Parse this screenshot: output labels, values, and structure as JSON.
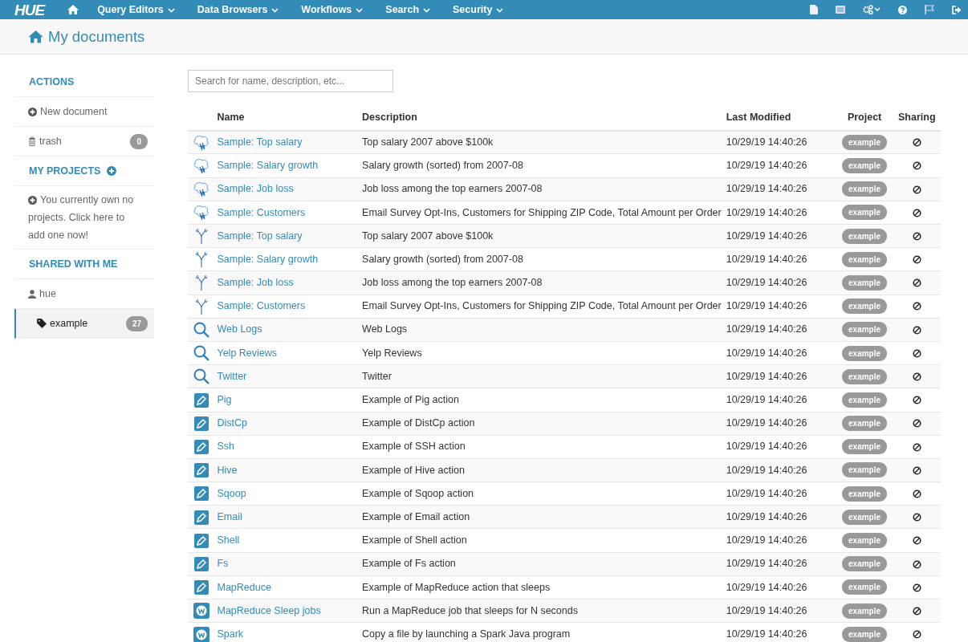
{
  "navbar": {
    "brand": "HUE",
    "menus": [
      {
        "label": "Query Editors"
      },
      {
        "label": "Data Browsers"
      },
      {
        "label": "Workflows"
      },
      {
        "label": "Search"
      },
      {
        "label": "Security"
      }
    ]
  },
  "page_title": "My documents",
  "sidebar": {
    "sections": [
      {
        "heading": "ACTIONS",
        "add": false,
        "items": [
          {
            "kind": "new",
            "label": "New document",
            "selected": false
          },
          {
            "kind": "trash",
            "label": "trash",
            "count": "0",
            "selected": false
          }
        ]
      },
      {
        "heading": "MY PROJECTS",
        "add": true,
        "items": [
          {
            "kind": "note",
            "label": "You currently own no projects. Click here to add one now!",
            "selected": false
          }
        ]
      },
      {
        "heading": "SHARED WITH ME",
        "add": false,
        "items": [
          {
            "kind": "user",
            "label": "hue",
            "selected": false
          },
          {
            "kind": "tag",
            "label": "example",
            "count": "27",
            "selected": true
          }
        ]
      }
    ]
  },
  "search": {
    "placeholder": "Search for name, description, etc..."
  },
  "table": {
    "columns": [
      "Name",
      "Description",
      "Last Modified",
      "Project",
      "Sharing"
    ],
    "rows": [
      {
        "kind": "hive",
        "name": "Sample: Top salary",
        "description": "Top salary 2007 above $100k",
        "modified": "10/29/19 14:40:26",
        "project": "example"
      },
      {
        "kind": "hive",
        "name": "Sample: Salary growth",
        "description": "Salary growth (sorted) from 2007-08",
        "modified": "10/29/19 14:40:26",
        "project": "example"
      },
      {
        "kind": "hive",
        "name": "Sample: Job loss",
        "description": "Job loss among the top earners 2007-08",
        "modified": "10/29/19 14:40:26",
        "project": "example"
      },
      {
        "kind": "hive",
        "name": "Sample: Customers",
        "description": "Email Survey Opt-Ins, Customers for Shipping ZIP Code, Total Amount per Order",
        "modified": "10/29/19 14:40:26",
        "project": "example"
      },
      {
        "kind": "impala",
        "name": "Sample: Top salary",
        "description": "Top salary 2007 above $100k",
        "modified": "10/29/19 14:40:26",
        "project": "example"
      },
      {
        "kind": "impala",
        "name": "Sample: Salary growth",
        "description": "Salary growth (sorted) from 2007-08",
        "modified": "10/29/19 14:40:26",
        "project": "example"
      },
      {
        "kind": "impala",
        "name": "Sample: Job loss",
        "description": "Job loss among the top earners 2007-08",
        "modified": "10/29/19 14:40:26",
        "project": "example"
      },
      {
        "kind": "impala",
        "name": "Sample: Customers",
        "description": "Email Survey Opt-Ins, Customers for Shipping ZIP Code, Total Amount per Order",
        "modified": "10/29/19 14:40:26",
        "project": "example"
      },
      {
        "kind": "search",
        "name": "Web Logs",
        "description": "Web Logs",
        "modified": "10/29/19 14:40:26",
        "project": "example"
      },
      {
        "kind": "search",
        "name": "Yelp Reviews",
        "description": "Yelp Reviews",
        "modified": "10/29/19 14:40:26",
        "project": "example"
      },
      {
        "kind": "search",
        "name": "Twitter",
        "description": "Twitter",
        "modified": "10/29/19 14:40:26",
        "project": "example"
      },
      {
        "kind": "action",
        "name": "Pig",
        "description": "Example of Pig action",
        "modified": "10/29/19 14:40:26",
        "project": "example"
      },
      {
        "kind": "action",
        "name": "DistCp",
        "description": "Example of DistCp action",
        "modified": "10/29/19 14:40:26",
        "project": "example"
      },
      {
        "kind": "action",
        "name": "Ssh",
        "description": "Example of SSH action",
        "modified": "10/29/19 14:40:26",
        "project": "example"
      },
      {
        "kind": "action",
        "name": "Hive",
        "description": "Example of Hive action",
        "modified": "10/29/19 14:40:26",
        "project": "example"
      },
      {
        "kind": "action",
        "name": "Sqoop",
        "description": "Example of Sqoop action",
        "modified": "10/29/19 14:40:26",
        "project": "example"
      },
      {
        "kind": "action",
        "name": "Email",
        "description": "Example of Email action",
        "modified": "10/29/19 14:40:26",
        "project": "example"
      },
      {
        "kind": "action",
        "name": "Shell",
        "description": "Example of Shell action",
        "modified": "10/29/19 14:40:26",
        "project": "example"
      },
      {
        "kind": "action",
        "name": "Fs",
        "description": "Example of Fs action",
        "modified": "10/29/19 14:40:26",
        "project": "example"
      },
      {
        "kind": "action",
        "name": "MapReduce",
        "description": "Example of MapReduce action that sleeps",
        "modified": "10/29/19 14:40:26",
        "project": "example"
      },
      {
        "kind": "workflow",
        "name": "MapReduce Sleep jobs",
        "description": "Run a MapReduce job that sleeps for N seconds",
        "modified": "10/29/19 14:40:26",
        "project": "example"
      },
      {
        "kind": "workflow",
        "name": "Spark",
        "description": "Copy a file by launching a Spark Java program",
        "modified": "10/29/19 14:40:26",
        "project": "example"
      }
    ]
  }
}
